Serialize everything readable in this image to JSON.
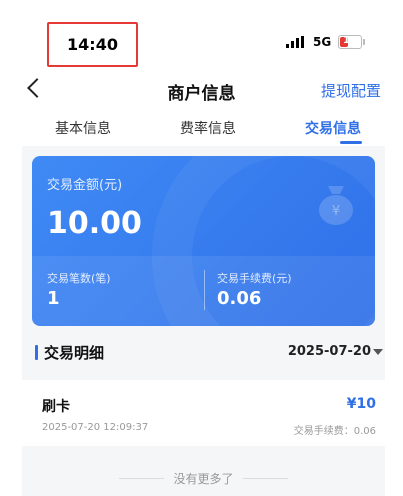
{
  "status_bar": {
    "time": "14:40",
    "network": "5G",
    "battery_level": "15",
    "battery_fraction": 0.15,
    "battery_color": "#e53935"
  },
  "nav": {
    "title": "商户信息",
    "action": "提现配置",
    "back_icon": "chevron-left-icon"
  },
  "tabs": [
    {
      "label": "基本信息",
      "active": false
    },
    {
      "label": "费率信息",
      "active": false
    },
    {
      "label": "交易信息",
      "active": true
    }
  ],
  "summary": {
    "amount_label": "交易金额(元)",
    "amount_value": "10.00",
    "count_label": "交易笔数(笔)",
    "count_value": "1",
    "fee_label": "交易手续费(元)",
    "fee_value": "0.06",
    "icon": "money-bag-icon"
  },
  "details": {
    "title": "交易明细",
    "date": "2025-07-20",
    "caret_icon": "caret-down-icon",
    "transactions": [
      {
        "type": "刷卡",
        "amount": "¥10",
        "time": "2025-07-20 12:09:37",
        "fee": "交易手续费：0.06"
      }
    ],
    "no_more": "没有更多了"
  },
  "colors": {
    "accent": "#2f6fe8",
    "card_gradient_start": "#3f8af5",
    "highlight_box": "#e53935"
  }
}
